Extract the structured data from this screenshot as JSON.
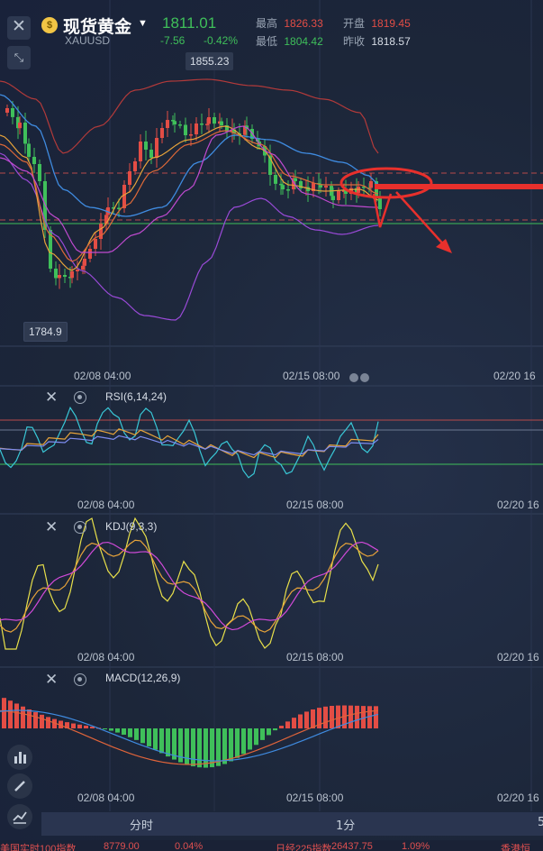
{
  "header": {
    "name": "现货黄金",
    "code": "XAUUSD",
    "last": "1811.01",
    "change": "-7.56",
    "change_pct": "-0.42%",
    "high_label": "最高",
    "high_value": "1826.33",
    "open_label": "开盘",
    "open_value": "1819.45",
    "low_label": "最低",
    "low_value": "1804.42",
    "prev_label": "昨收",
    "prev_value": "1818.57"
  },
  "main": {
    "max_tag": "1855.23",
    "min_tag": "1784.9",
    "time_labels": [
      "02/08 04:00",
      "02/15 08:00",
      "02/20 16"
    ]
  },
  "rsi": {
    "title": "RSI(6,14,24)",
    "time_labels": [
      "02/08 04:00",
      "02/15 08:00",
      "02/20 16"
    ]
  },
  "kdj": {
    "title": "KDJ(9,3,3)",
    "time_labels": [
      "02/08 04:00",
      "02/15 08:00",
      "02/20 16"
    ]
  },
  "macd": {
    "title": "MACD(12,26,9)",
    "time_labels": [
      "02/08 04:00",
      "02/15 08:00",
      "02/20 16"
    ]
  },
  "tabs": {
    "minute": "分时",
    "one_min": "1分",
    "five": "5"
  },
  "ticker": {
    "a": "美国实时100指数",
    "b": "8779.00",
    "c": "0.04%",
    "d": "日经225指数",
    "e": "26437.75",
    "f": "1.09%",
    "g": "香港恒"
  },
  "colors": {
    "up": "#e34d45",
    "down": "#3fbf5a",
    "accent": "#e8302c"
  }
}
